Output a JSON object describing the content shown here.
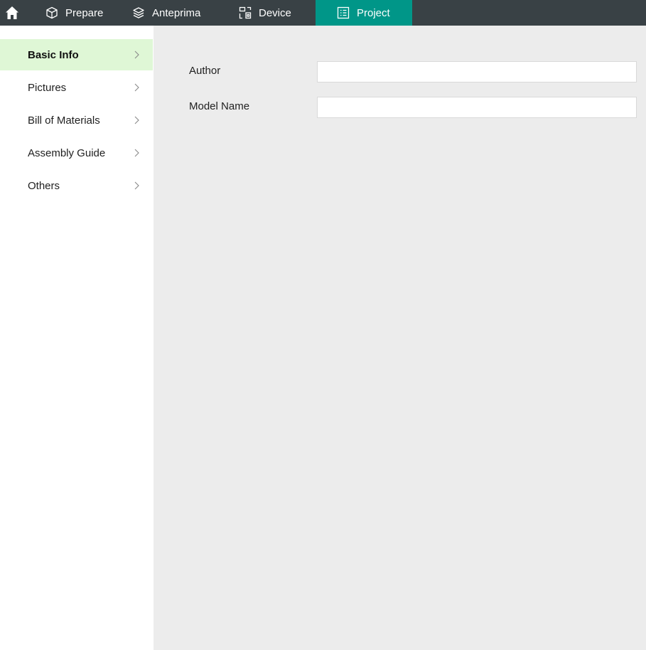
{
  "topbar": {
    "home_icon": "home-icon",
    "tabs": [
      {
        "label": "Prepare",
        "icon": "cube-icon"
      },
      {
        "label": "Anteprima",
        "icon": "layers-icon"
      },
      {
        "label": "Device",
        "icon": "device-icon"
      },
      {
        "label": "Project",
        "icon": "project-icon",
        "active": true
      }
    ],
    "colors": {
      "bar": "#394145",
      "active_tab": "#009688"
    }
  },
  "sidebar": {
    "items": [
      {
        "label": "Basic Info",
        "active": true
      },
      {
        "label": "Pictures"
      },
      {
        "label": "Bill of Materials"
      },
      {
        "label": "Assembly Guide"
      },
      {
        "label": "Others"
      }
    ],
    "colors": {
      "active_bg": "#dff7d6"
    }
  },
  "form": {
    "author_label": "Author",
    "author_value": "",
    "model_name_label": "Model Name",
    "model_name_value": ""
  }
}
